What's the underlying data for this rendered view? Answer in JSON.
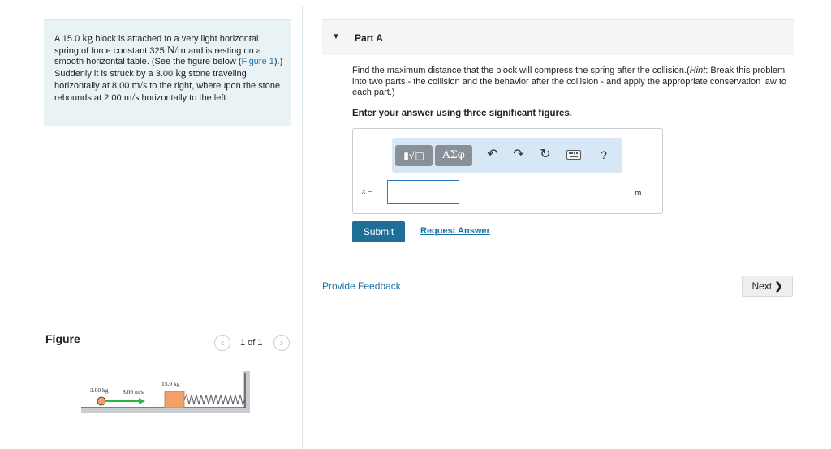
{
  "problem": {
    "seg1": "A 15.0 ",
    "kg1": "kg",
    "seg2": " block is attached to a very light horizontal spring of force constant 325 ",
    "units1": "N/m",
    "seg3": " and is resting on a smooth horizontal table. (See the figure below (",
    "figure_link": "Figure 1",
    "seg4": ").) Suddenly it is struck by a 3.00 ",
    "kg2": "kg",
    "seg5": " stone traveling horizontally at 8.00 ",
    "units2": "m/s",
    "seg6": " to the right, whereupon the stone rebounds at 2.00 ",
    "units3": "m/s",
    "seg7": " horizontally to the left."
  },
  "figure": {
    "label": "Figure",
    "counter": "1 of 1",
    "stone_mass": "3.00 kg",
    "stone_speed": "8.00 m/s",
    "block_mass": "15.0 kg"
  },
  "part": {
    "title": "Part A",
    "question_pre": "Find the maximum distance that the block will compress the spring after the collision.(",
    "hint_label": "Hint",
    "question_post": ": Break this problem into two parts - the collision and the behavior after the collision - and apply the appropriate conservation law to each part.)",
    "instruction": "Enter your answer using three significant figures.",
    "variable": "x =",
    "unit": "m",
    "answer_value": "",
    "toolbar": {
      "math_label": "▮√□",
      "greek_label": "AΣφ",
      "undo_icon": "undo-icon",
      "redo_icon": "redo-icon",
      "reset_icon": "reset-icon",
      "keyboard_icon": "keyboard-icon",
      "help_label": "?"
    },
    "submit": "Submit",
    "request_answer": "Request Answer"
  },
  "footer": {
    "feedback": "Provide Feedback",
    "next": "Next"
  },
  "colors": {
    "problem_bg": "#e9f3f5",
    "toolbar_bg": "#d7e7f6",
    "submit_bg": "#1d6f97",
    "link": "#1a6fa8",
    "block": "#f2a06a",
    "arrow": "#2db34a"
  }
}
